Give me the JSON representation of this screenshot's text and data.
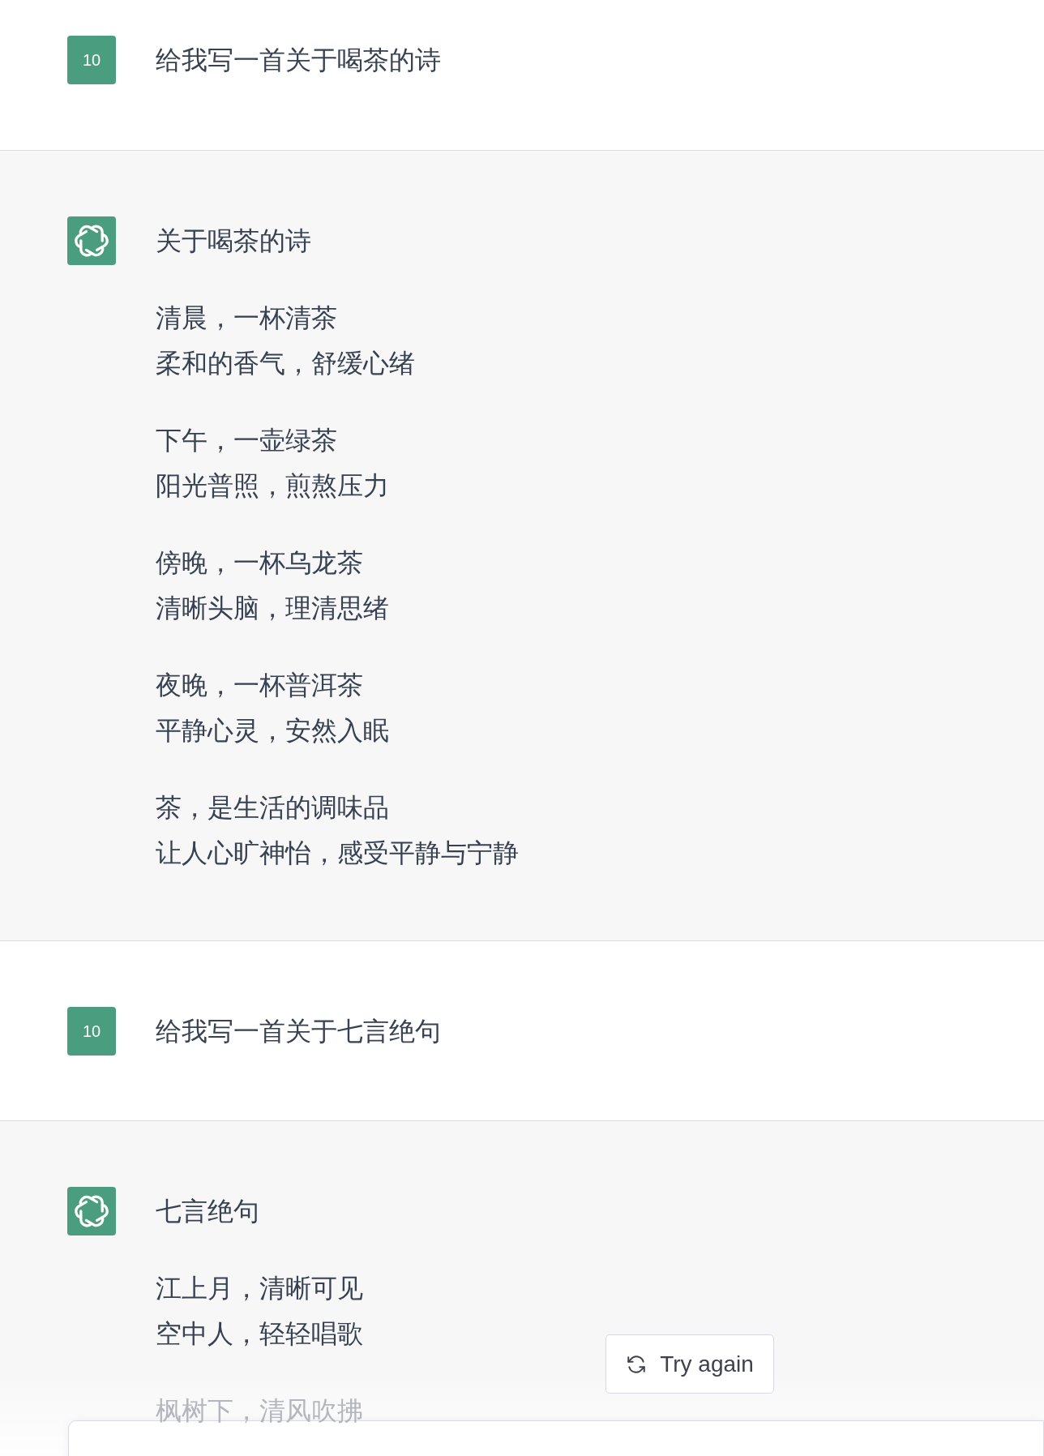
{
  "messages": [
    {
      "kind": "user",
      "avatar": "10",
      "text": "给我写一首关于喝茶的诗"
    },
    {
      "kind": "assistant",
      "title": "关于喝茶的诗",
      "stanzas": [
        [
          "清晨，一杯清茶",
          "柔和的香气，舒缓心绪"
        ],
        [
          "下午，一壶绿茶",
          "阳光普照，煎熬压力"
        ],
        [
          "傍晚，一杯乌龙茶",
          "清晰头脑，理清思绪"
        ],
        [
          "夜晚，一杯普洱茶",
          "平静心灵，安然入眠"
        ],
        [
          "茶，是生活的调味品",
          "让人心旷神怡，感受平静与宁静"
        ]
      ]
    },
    {
      "kind": "user",
      "avatar": "10",
      "text": "给我写一首关于七言绝句"
    },
    {
      "kind": "assistant",
      "title": "七言绝句",
      "stanzas": [
        [
          "江上月，清晰可见",
          "空中人，轻轻唱歌"
        ],
        [
          "枫树下，清风吹拂"
        ]
      ]
    }
  ],
  "try_again_button": {
    "label": "Try again"
  }
}
